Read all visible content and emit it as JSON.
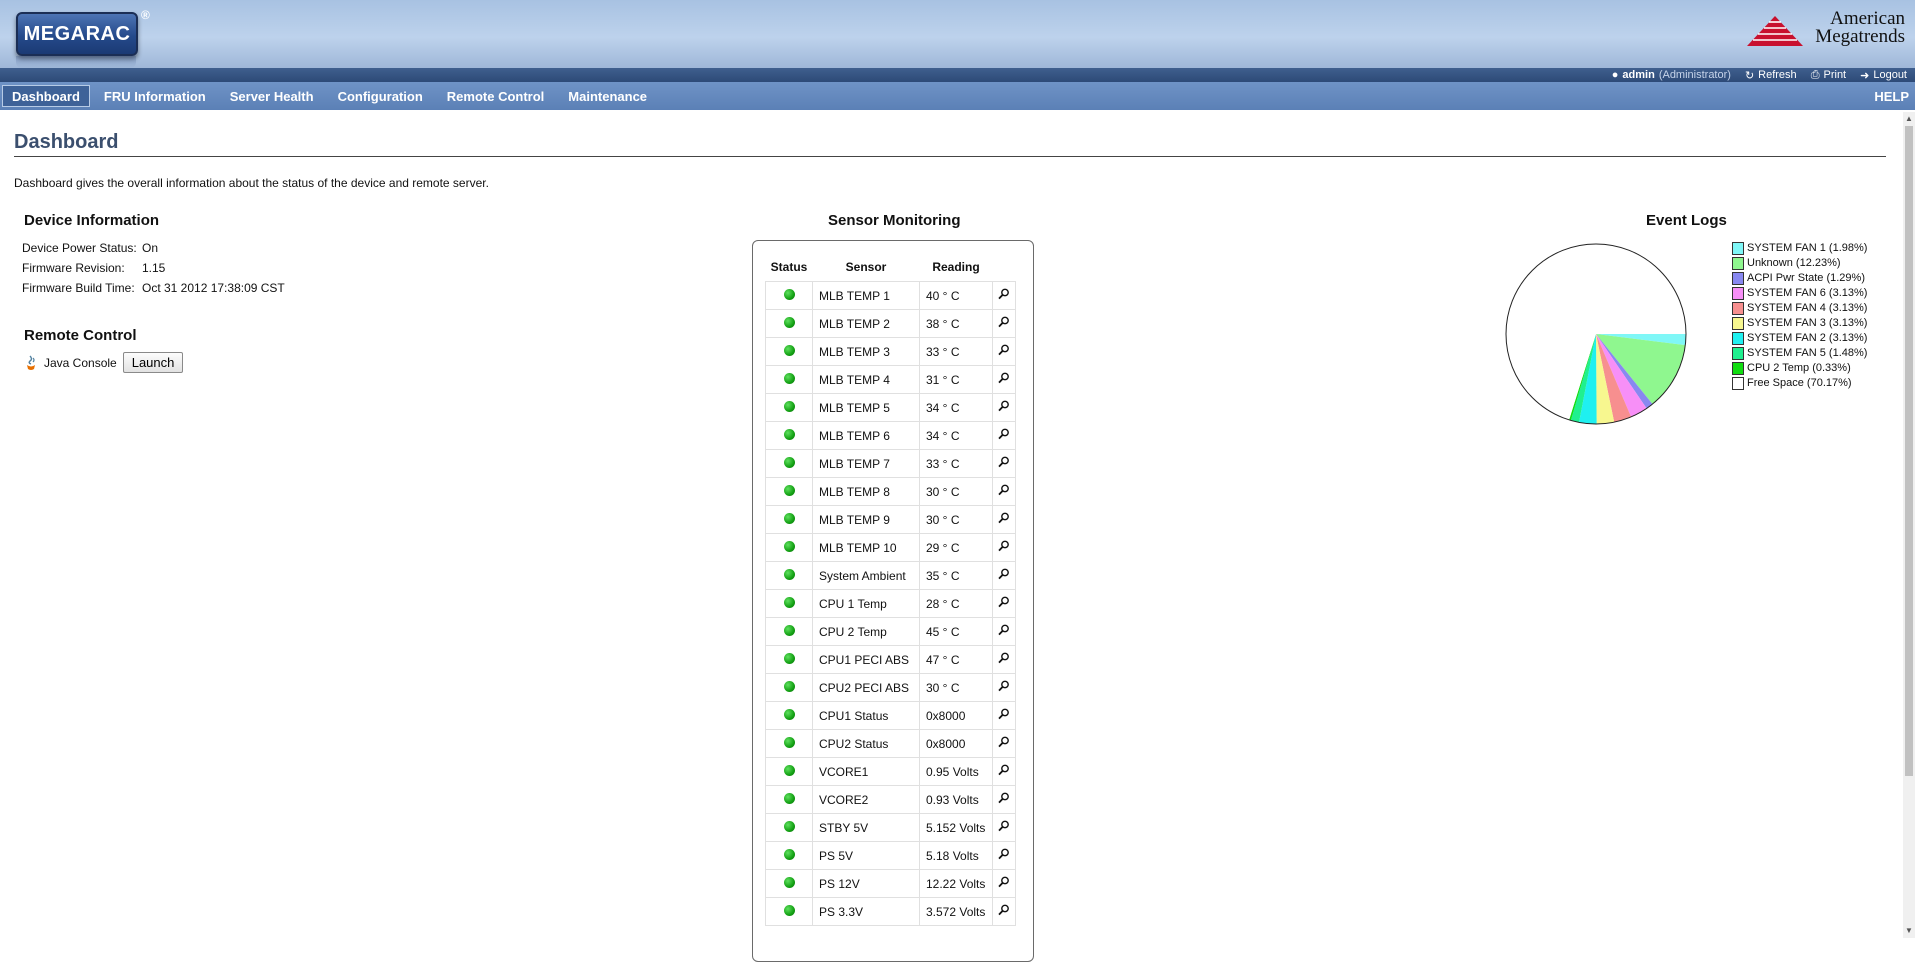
{
  "header": {
    "logo_text": "MEGARAC",
    "logo_registered": "®",
    "vendor_line1": "American",
    "vendor_line2": "Megatrends",
    "user": "admin",
    "role": "(Administrator)",
    "refresh_label": "Refresh",
    "print_label": "Print",
    "logout_label": "Logout"
  },
  "nav": {
    "items": [
      {
        "label": "Dashboard",
        "active": true
      },
      {
        "label": "FRU Information"
      },
      {
        "label": "Server Health"
      },
      {
        "label": "Configuration"
      },
      {
        "label": "Remote Control"
      },
      {
        "label": "Maintenance"
      }
    ],
    "help_label": "HELP"
  },
  "page": {
    "title": "Dashboard",
    "description": "Dashboard gives the overall information about the status of the device and remote server."
  },
  "device_info": {
    "heading": "Device Information",
    "rows": [
      {
        "label": "Device Power Status:",
        "value": "On"
      },
      {
        "label": "Firmware Revision:",
        "value": "1.15"
      },
      {
        "label": "Firmware Build Time:",
        "value": "Oct 31 2012 17:38:09 CST"
      }
    ]
  },
  "remote_control": {
    "heading": "Remote Control",
    "java_console_label": "Java Console",
    "launch_label": "Launch"
  },
  "sensor_monitoring": {
    "heading": "Sensor Monitoring",
    "columns": [
      "Status",
      "Sensor",
      "Reading"
    ],
    "rows": [
      {
        "sensor": "MLB TEMP 1",
        "reading": "40 ° C"
      },
      {
        "sensor": "MLB TEMP 2",
        "reading": "38 ° C"
      },
      {
        "sensor": "MLB TEMP 3",
        "reading": "33 ° C"
      },
      {
        "sensor": "MLB TEMP 4",
        "reading": "31 ° C"
      },
      {
        "sensor": "MLB TEMP 5",
        "reading": "34 ° C"
      },
      {
        "sensor": "MLB TEMP 6",
        "reading": "34 ° C"
      },
      {
        "sensor": "MLB TEMP 7",
        "reading": "33 ° C"
      },
      {
        "sensor": "MLB TEMP 8",
        "reading": "30 ° C"
      },
      {
        "sensor": "MLB TEMP 9",
        "reading": "30 ° C"
      },
      {
        "sensor": "MLB TEMP 10",
        "reading": "29 ° C"
      },
      {
        "sensor": "System Ambient",
        "reading": "35 ° C"
      },
      {
        "sensor": "CPU 1 Temp",
        "reading": "28 ° C"
      },
      {
        "sensor": "CPU 2 Temp",
        "reading": "45 ° C"
      },
      {
        "sensor": "CPU1 PECI ABS",
        "reading": "47 ° C"
      },
      {
        "sensor": "CPU2 PECI ABS",
        "reading": "30 ° C"
      },
      {
        "sensor": "CPU1 Status",
        "reading": "0x8000"
      },
      {
        "sensor": "CPU2 Status",
        "reading": "0x8000"
      },
      {
        "sensor": "VCORE1",
        "reading": "0.95 Volts"
      },
      {
        "sensor": "VCORE2",
        "reading": "0.93 Volts"
      },
      {
        "sensor": "STBY 5V",
        "reading": "5.152 Volts"
      },
      {
        "sensor": "PS 5V",
        "reading": "5.18 Volts"
      },
      {
        "sensor": "PS 12V",
        "reading": "12.22 Volts"
      },
      {
        "sensor": "PS 3.3V",
        "reading": "3.572 Volts"
      }
    ],
    "status_color": "#13a013"
  },
  "event_logs": {
    "heading": "Event Logs"
  },
  "chart_data": {
    "type": "pie",
    "title": "Event Logs",
    "legend_position": "right",
    "slices": [
      {
        "label": "SYSTEM FAN 1 (1.98%)",
        "value": 1.98,
        "color": "#7ff7f7"
      },
      {
        "label": "Unknown (12.23%)",
        "value": 12.23,
        "color": "#8ff78f"
      },
      {
        "label": "ACPI Pwr State (1.29%)",
        "value": 1.29,
        "color": "#8888f0"
      },
      {
        "label": "SYSTEM FAN 6 (3.13%)",
        "value": 3.13,
        "color": "#f78ff7"
      },
      {
        "label": "SYSTEM FAN 4 (3.13%)",
        "value": 3.13,
        "color": "#f78f8f"
      },
      {
        "label": "SYSTEM FAN 3 (3.13%)",
        "value": 3.13,
        "color": "#f7f78f"
      },
      {
        "label": "SYSTEM FAN 2 (3.13%)",
        "value": 3.13,
        "color": "#1ff0f0"
      },
      {
        "label": "SYSTEM FAN 5 (1.48%)",
        "value": 1.48,
        "color": "#1ff08f"
      },
      {
        "label": "CPU 2 Temp (0.33%)",
        "value": 0.33,
        "color": "#11dd11"
      },
      {
        "label": "Free Space (70.17%)",
        "value": 70.17,
        "color": "#ffffff"
      }
    ]
  }
}
